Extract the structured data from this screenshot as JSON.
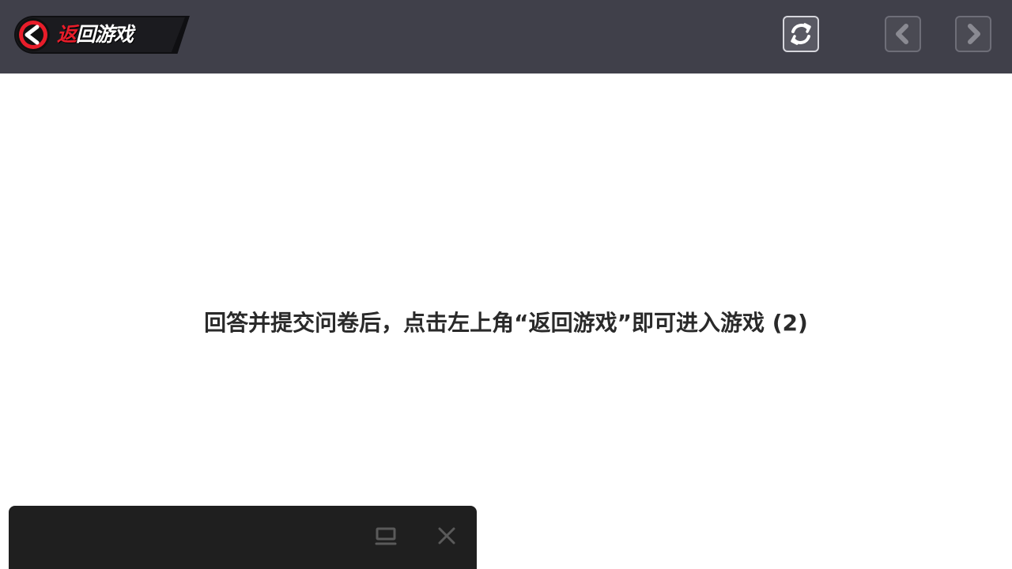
{
  "header": {
    "back_button": {
      "label_highlight": "返",
      "label_rest": "回游戏",
      "accent_color": "#e81d2a",
      "icon": "back-arrow-circle-icon"
    },
    "refresh_icon": "refresh-icon",
    "prev_icon": "chevron-left-icon",
    "next_icon": "chevron-right-icon",
    "background_color": "#40404a"
  },
  "main": {
    "message": "回答并提交问卷后，点击左上角“返回游戏”即可进入游戏 (2)"
  },
  "floating_panel": {
    "minimize_icon": "minimize-icon",
    "close_icon": "close-icon",
    "background_color": "#1f1f1f"
  }
}
